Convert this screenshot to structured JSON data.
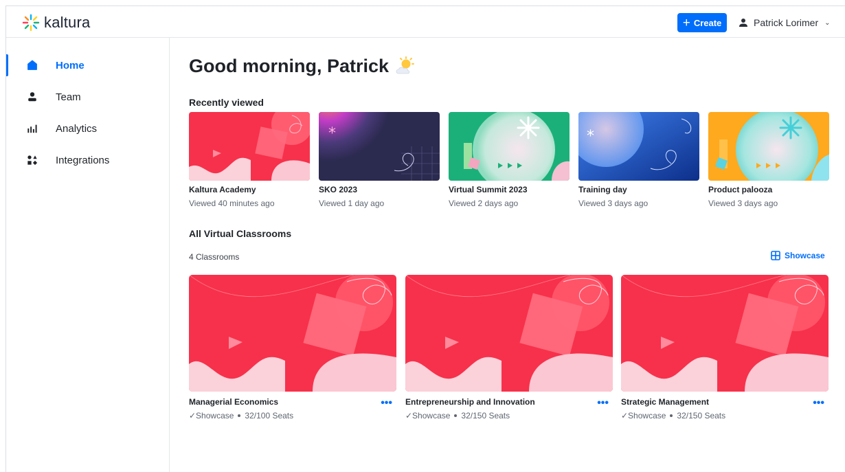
{
  "app": {
    "logo_text": "kaltura"
  },
  "header": {
    "create_label": "Create",
    "user_name": "Patrick Lorimer"
  },
  "sidebar": {
    "items": [
      {
        "label": "Home",
        "icon": "home-icon",
        "active": true
      },
      {
        "label": "Team",
        "icon": "person-icon",
        "active": false
      },
      {
        "label": "Analytics",
        "icon": "bar-chart-icon",
        "active": false
      },
      {
        "label": "Integrations",
        "icon": "integrations-icon",
        "active": false
      }
    ]
  },
  "main": {
    "greeting": "Good morning, Patrick",
    "recently_viewed": {
      "title": "Recently viewed",
      "items": [
        {
          "title": "Kaltura Academy",
          "viewed": "Viewed 40 minutes ago"
        },
        {
          "title": "SKO 2023",
          "viewed": "Viewed 1 day ago"
        },
        {
          "title": "Virtual Summit 2023",
          "viewed": "Viewed 2 days ago"
        },
        {
          "title": "Training day",
          "viewed": "Viewed 3 days ago"
        },
        {
          "title": "Product palooza",
          "viewed": "Viewed 3 days ago"
        }
      ]
    },
    "classrooms": {
      "title": "All Virtual Classrooms",
      "count": "4 Classrooms",
      "view_toggle": "Showcase",
      "items": [
        {
          "title": "Managerial Economics",
          "mode": "✓Showcase",
          "seats": "32/100 Seats",
          "more": "•••"
        },
        {
          "title": "Entrepreneurship and Innovation",
          "mode": "✓Showcase",
          "seats": "32/150 Seats",
          "more": "•••"
        },
        {
          "title": "Strategic Management",
          "mode": "✓Showcase",
          "seats": "32/150 Seats",
          "more": "•••"
        }
      ]
    }
  },
  "colors": {
    "accent": "#006efa",
    "thumb_red": "#f7314b",
    "thumb_navy": "#2b2a4f",
    "thumb_green": "#1bb07a",
    "thumb_blue": "#1a4fc0",
    "thumb_orange": "#ffa91e"
  }
}
